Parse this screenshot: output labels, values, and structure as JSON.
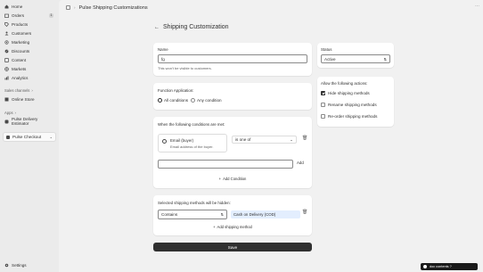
{
  "sidebar": {
    "items": [
      {
        "label": "Home",
        "icon": "home-icon"
      },
      {
        "label": "Orders",
        "icon": "orders-icon",
        "badge": "1"
      },
      {
        "label": "Products",
        "icon": "tag-icon"
      },
      {
        "label": "Customers",
        "icon": "person-icon"
      },
      {
        "label": "Marketing",
        "icon": "target-icon"
      },
      {
        "label": "Discounts",
        "icon": "discount-icon"
      },
      {
        "label": "Content",
        "icon": "content-icon"
      },
      {
        "label": "Markets",
        "icon": "globe-icon"
      },
      {
        "label": "Analytics",
        "icon": "chart-icon"
      }
    ],
    "sales_channels_label": "Sales channels",
    "online_store_label": "Online Store",
    "apps_label": "Apps",
    "pulse_delivery_label": "Pulse Delivery Estimator",
    "pulse_checkout_label": "Pulse Checkout",
    "settings_label": "Settings"
  },
  "topbar": {
    "title": "Pulse Shipping Customizations"
  },
  "page": {
    "title": "Shipping Customization",
    "name_label": "Name",
    "name_value": "fg",
    "name_help": "This won't be visible to customers.",
    "function_label": "Function Application:",
    "all_conditions": "All conditions",
    "any_condition": "Any condition",
    "conditions_label": "When the following conditions are met:",
    "condition_title": "Email (buyer)",
    "condition_desc": "Email address of the buyer.",
    "operator_value": "is one of",
    "add_label": "Add",
    "add_condition_label": "Add Condition",
    "hidden_label": "Selected shipping methods will be hidden:",
    "contains_value": "Contains",
    "method_tag": "Cash on Delivery (COD)",
    "add_method_label": "Add shipping method",
    "save_label": "Save"
  },
  "status": {
    "label": "Status",
    "value": "Active"
  },
  "actions": {
    "label": "Allow the following actions:",
    "items": [
      {
        "label": "Hide shipping methods",
        "checked": true
      },
      {
        "label": "Rename shipping methods",
        "checked": false
      },
      {
        "label": "Re-order shipping methods",
        "checked": false
      }
    ]
  },
  "toast": {
    "text": "doc contents ?"
  }
}
